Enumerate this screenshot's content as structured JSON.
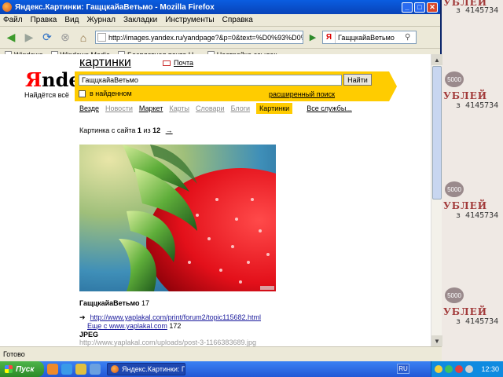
{
  "window": {
    "title": "Яндекс.Картинки: ГащцкайаВетьмо - Mozilla Firefox"
  },
  "menu": [
    "Файл",
    "Правка",
    "Вид",
    "Журнал",
    "Закладки",
    "Инструменты",
    "Справка"
  ],
  "navbar": {
    "url": "http://images.yandex.ru/yandpage?&p=0&text=%D0%93%D0%B0%D1%86%D1%",
    "search_value": "ГащцкайаВетьмо",
    "search_engine_icon": "Я"
  },
  "bookmarks": [
    "Windows",
    "Windows Media",
    "Бесплатная почта Н...",
    "Настройка ссылок"
  ],
  "page": {
    "logo_prefix": "Я",
    "logo_rest": "ndex",
    "slogan": "Найдётся всё",
    "service_title": "картинки",
    "mail_link": "Почта",
    "query": "ГащцкайаВетьмо",
    "find_button": "Найти",
    "in_found_label": "в найденном",
    "advanced_search": "расширенный поиск",
    "tabs": [
      {
        "label": "Везде",
        "state": "normal"
      },
      {
        "label": "Новости",
        "state": "gray"
      },
      {
        "label": "Маркет",
        "state": "normal"
      },
      {
        "label": "Карты",
        "state": "gray"
      },
      {
        "label": "Словари",
        "state": "gray"
      },
      {
        "label": "Блоги",
        "state": "gray"
      },
      {
        "label": "Картинки",
        "state": "active"
      }
    ],
    "all_services": "Все службы...",
    "pic_info_prefix": "Картинка с сайта",
    "pic_index": "1",
    "pic_of": "из",
    "pic_total": "12",
    "next_arrow": "→",
    "image_title": "ГащцкайаВетьмо",
    "image_title_count": "17",
    "source_arrow": "➔",
    "source_link": "http://www.yaplakal.com/print/forum2/topic115682.html",
    "more_link": "Еще с www.yaplakal.com",
    "more_count": "172",
    "format": "JPEG",
    "image_url": "http://www.yaplakal.com/uploads/post-3-1166383689.jpg"
  },
  "status_text": "Готово",
  "taskbar": {
    "start_label": "Пуск",
    "task_label": "Яндекс.Картинки: Гац...",
    "language": "RU",
    "clock": "12:30"
  },
  "wallpaper": {
    "denomination": "5000",
    "word": "УБЛЕЙ",
    "serial": "з 4145734"
  },
  "colors": {
    "yandex_yellow": "#ffcc00",
    "logo_red": "#ff0000",
    "link_blue": "#1a1a9c",
    "xp_blue": "#2258d6"
  }
}
